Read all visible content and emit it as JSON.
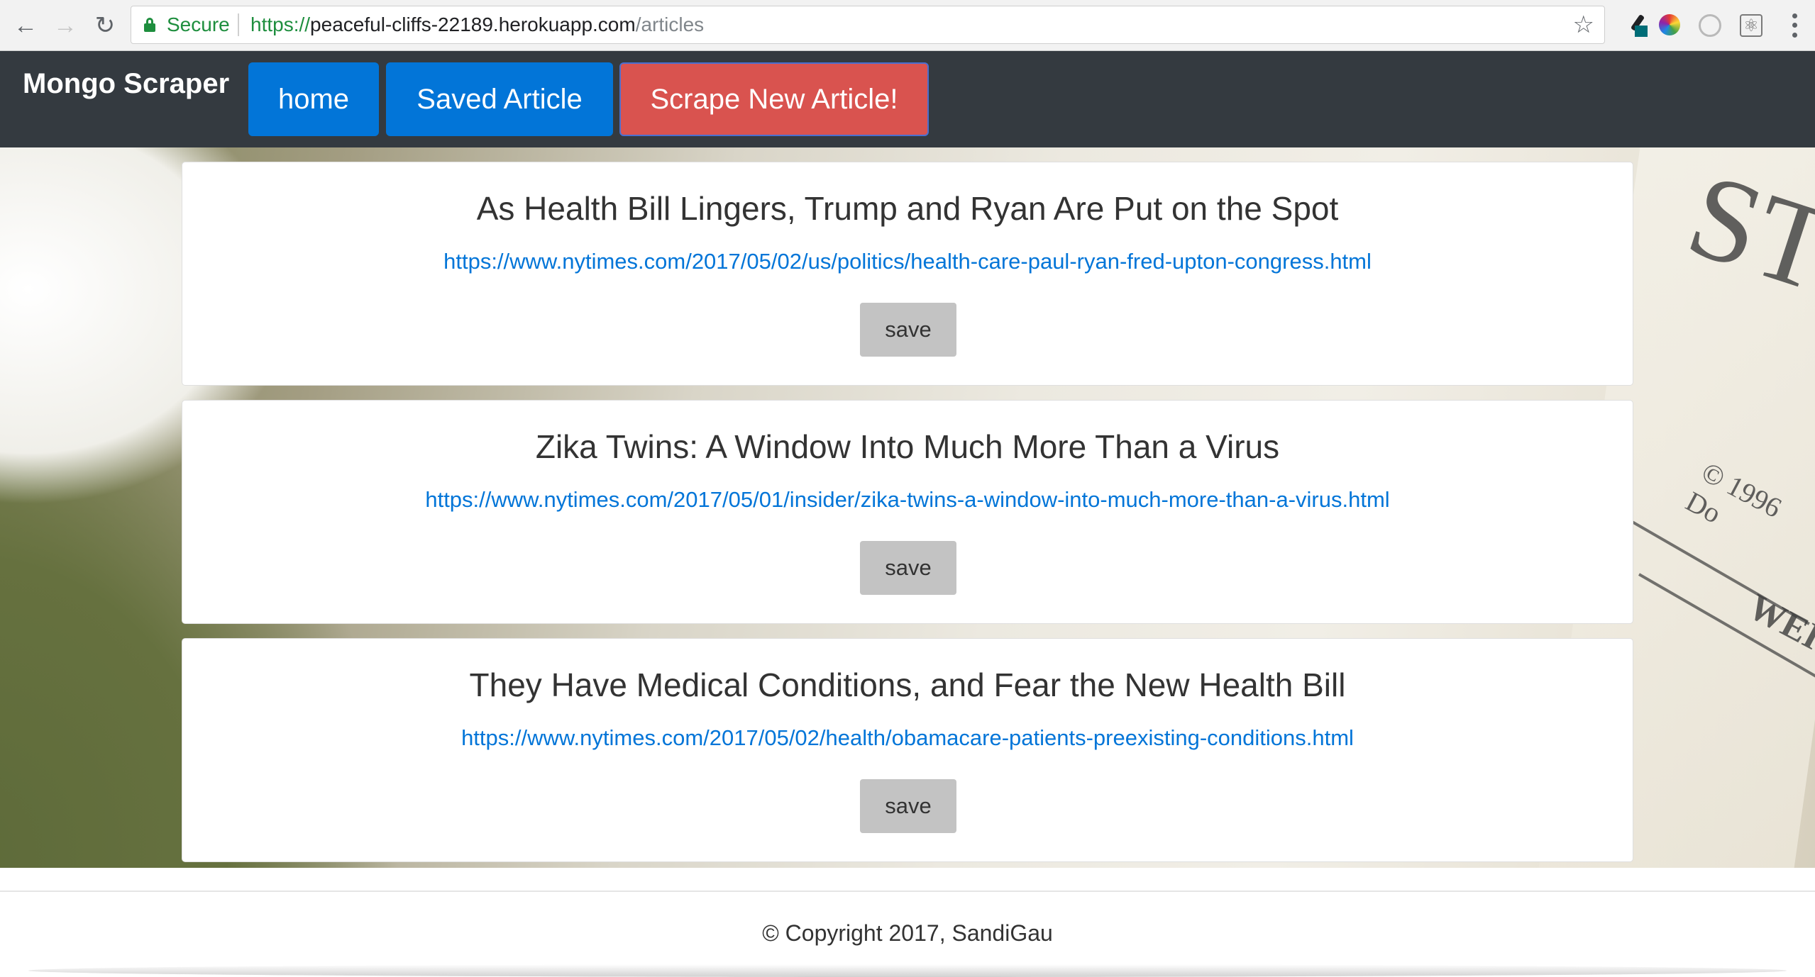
{
  "browser": {
    "back_icon": "←",
    "forward_icon": "→",
    "reload_icon": "↻",
    "security_label": "Secure",
    "url_scheme": "https://",
    "url_host": "peaceful-cliffs-22189.herokuapp.com",
    "url_path": "/articles",
    "bookmark_icon": "☆",
    "react_icon": "⚛"
  },
  "navbar": {
    "brand": "Mongo Scraper",
    "home_label": "home",
    "saved_label": "Saved Article",
    "scrape_label": "Scrape New Article!"
  },
  "articles": [
    {
      "title": "As Health Bill Lingers, Trump and Ryan Are Put on the Spot",
      "link": "https://www.nytimes.com/2017/05/02/us/politics/health-care-paul-ryan-fred-upton-congress.html",
      "save_label": "save"
    },
    {
      "title": "Zika Twins: A Window Into Much More Than a Virus",
      "link": "https://www.nytimes.com/2017/05/01/insider/zika-twins-a-window-into-much-more-than-a-virus.html",
      "save_label": "save"
    },
    {
      "title": "They Have Medical Conditions, and Fear the New Health Bill",
      "link": "https://www.nytimes.com/2017/05/02/health/obamacare-patients-preexisting-conditions.html",
      "save_label": "save"
    }
  ],
  "footer": {
    "copyright": "© Copyright 2017, SandiGau"
  },
  "background": {
    "newspaper_text": [
      "STR",
      "© 1996 Do",
      "WEI"
    ]
  }
}
